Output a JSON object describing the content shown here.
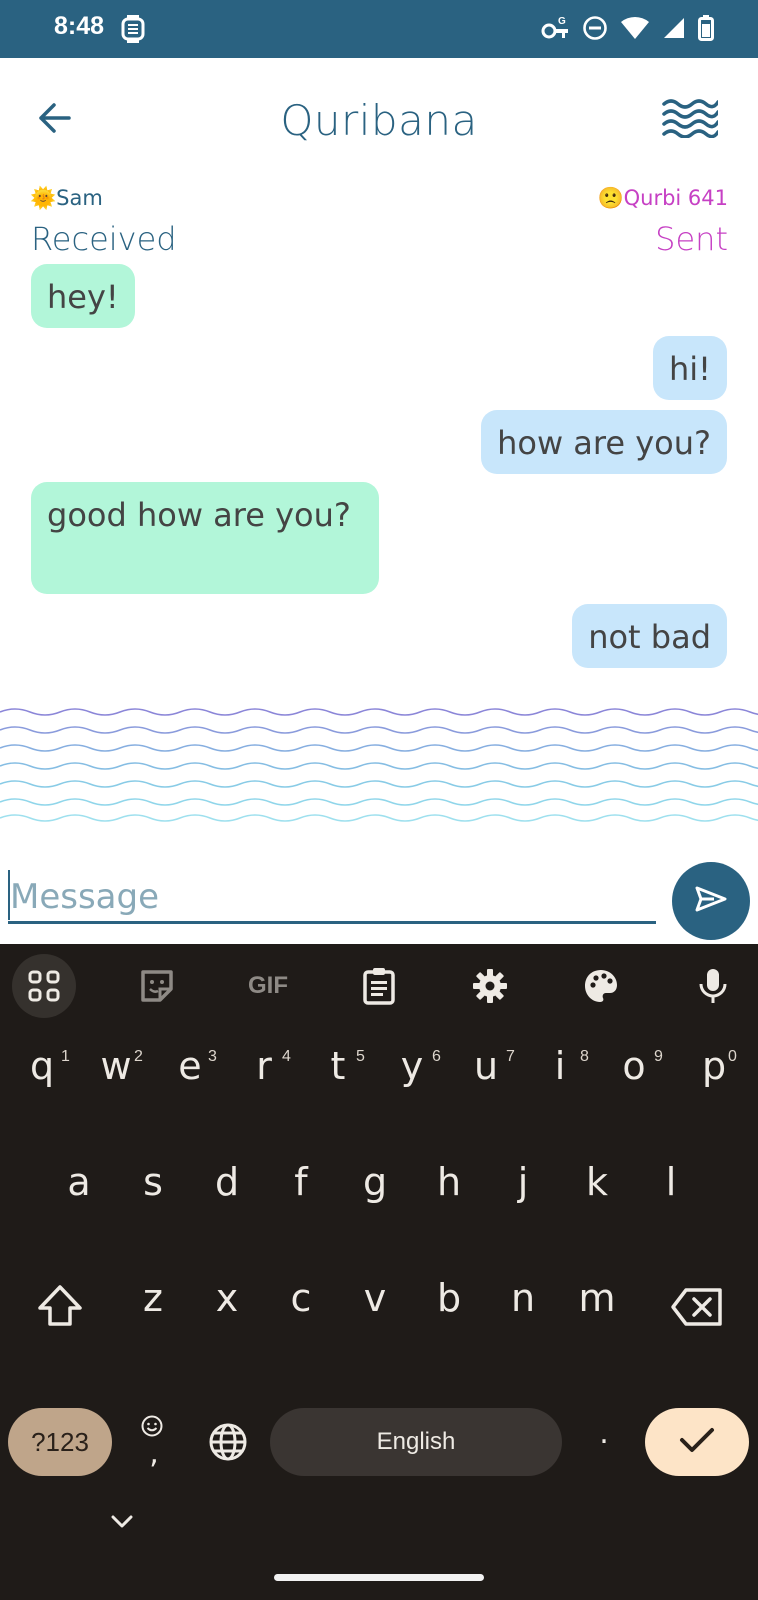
{
  "status": {
    "time": "8:48"
  },
  "app": {
    "title": "Quribana"
  },
  "chat": {
    "left_user": "🌞Sam",
    "right_user": "🙁Qurbi 641",
    "left_label": "Received",
    "right_label": "Sent",
    "messages": [
      {
        "side": "received",
        "text": "hey!"
      },
      {
        "side": "sent",
        "text": "hi!"
      },
      {
        "side": "sent",
        "text": "how are you?"
      },
      {
        "side": "received",
        "text": "good how are you?"
      },
      {
        "side": "sent",
        "text": "not bad"
      }
    ]
  },
  "composer": {
    "placeholder": "Message"
  },
  "keyboard": {
    "toolbar": [
      "apps-grid",
      "sticker",
      "GIF",
      "clipboard",
      "settings",
      "palette",
      "microphone"
    ],
    "gif_label": "GIF",
    "row1": [
      "q",
      "w",
      "e",
      "r",
      "t",
      "y",
      "u",
      "i",
      "o",
      "p"
    ],
    "row1_hints": [
      "1",
      "2",
      "3",
      "4",
      "5",
      "6",
      "7",
      "8",
      "9",
      "0"
    ],
    "row2": [
      "a",
      "s",
      "d",
      "f",
      "g",
      "h",
      "j",
      "k",
      "l"
    ],
    "row3": [
      "z",
      "x",
      "c",
      "v",
      "b",
      "n",
      "m"
    ],
    "symbols_label": "?123",
    "comma": ",",
    "period": ".",
    "space_label": "English"
  },
  "colors": {
    "primary": "#2a6281",
    "sent_accent": "#c640c4",
    "received_bubble": "#b2f6d9",
    "sent_bubble": "#c8e6fb"
  }
}
